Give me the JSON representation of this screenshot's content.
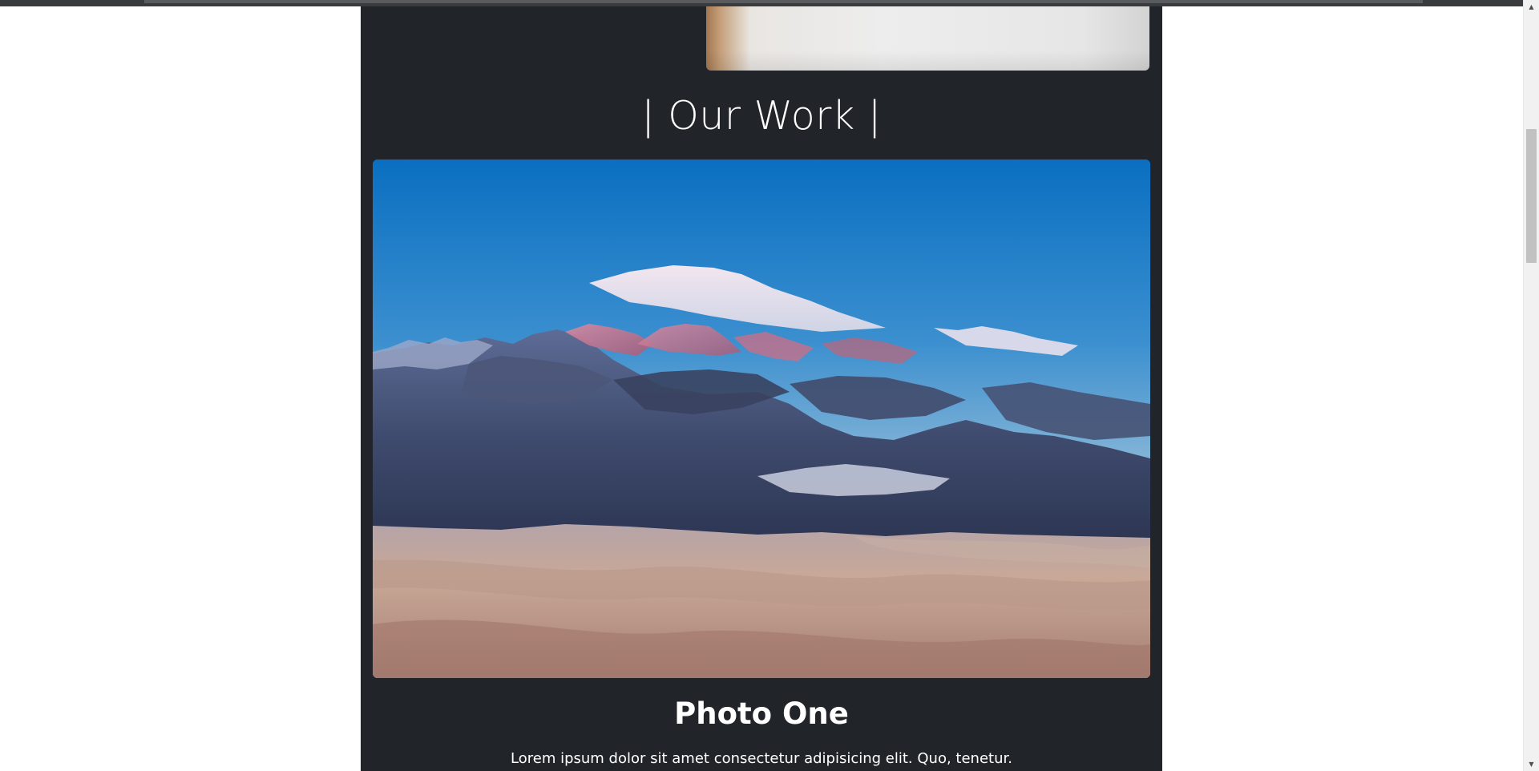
{
  "section": {
    "title": "| Our Work |"
  },
  "gallery": {
    "items": [
      {
        "title": "Photo One",
        "text": "Lorem ipsum dolor sit amet consectetur adipisicing elit. Quo, tenetur.",
        "image_subject": "snow-capped mountain above sand dunes"
      }
    ]
  },
  "scrollbar": {
    "up_icon": "arrow-up-icon",
    "down_icon": "arrow-down-icon"
  },
  "colors": {
    "page_background": "#ffffff",
    "content_background": "#212529",
    "text": "#ffffff"
  }
}
